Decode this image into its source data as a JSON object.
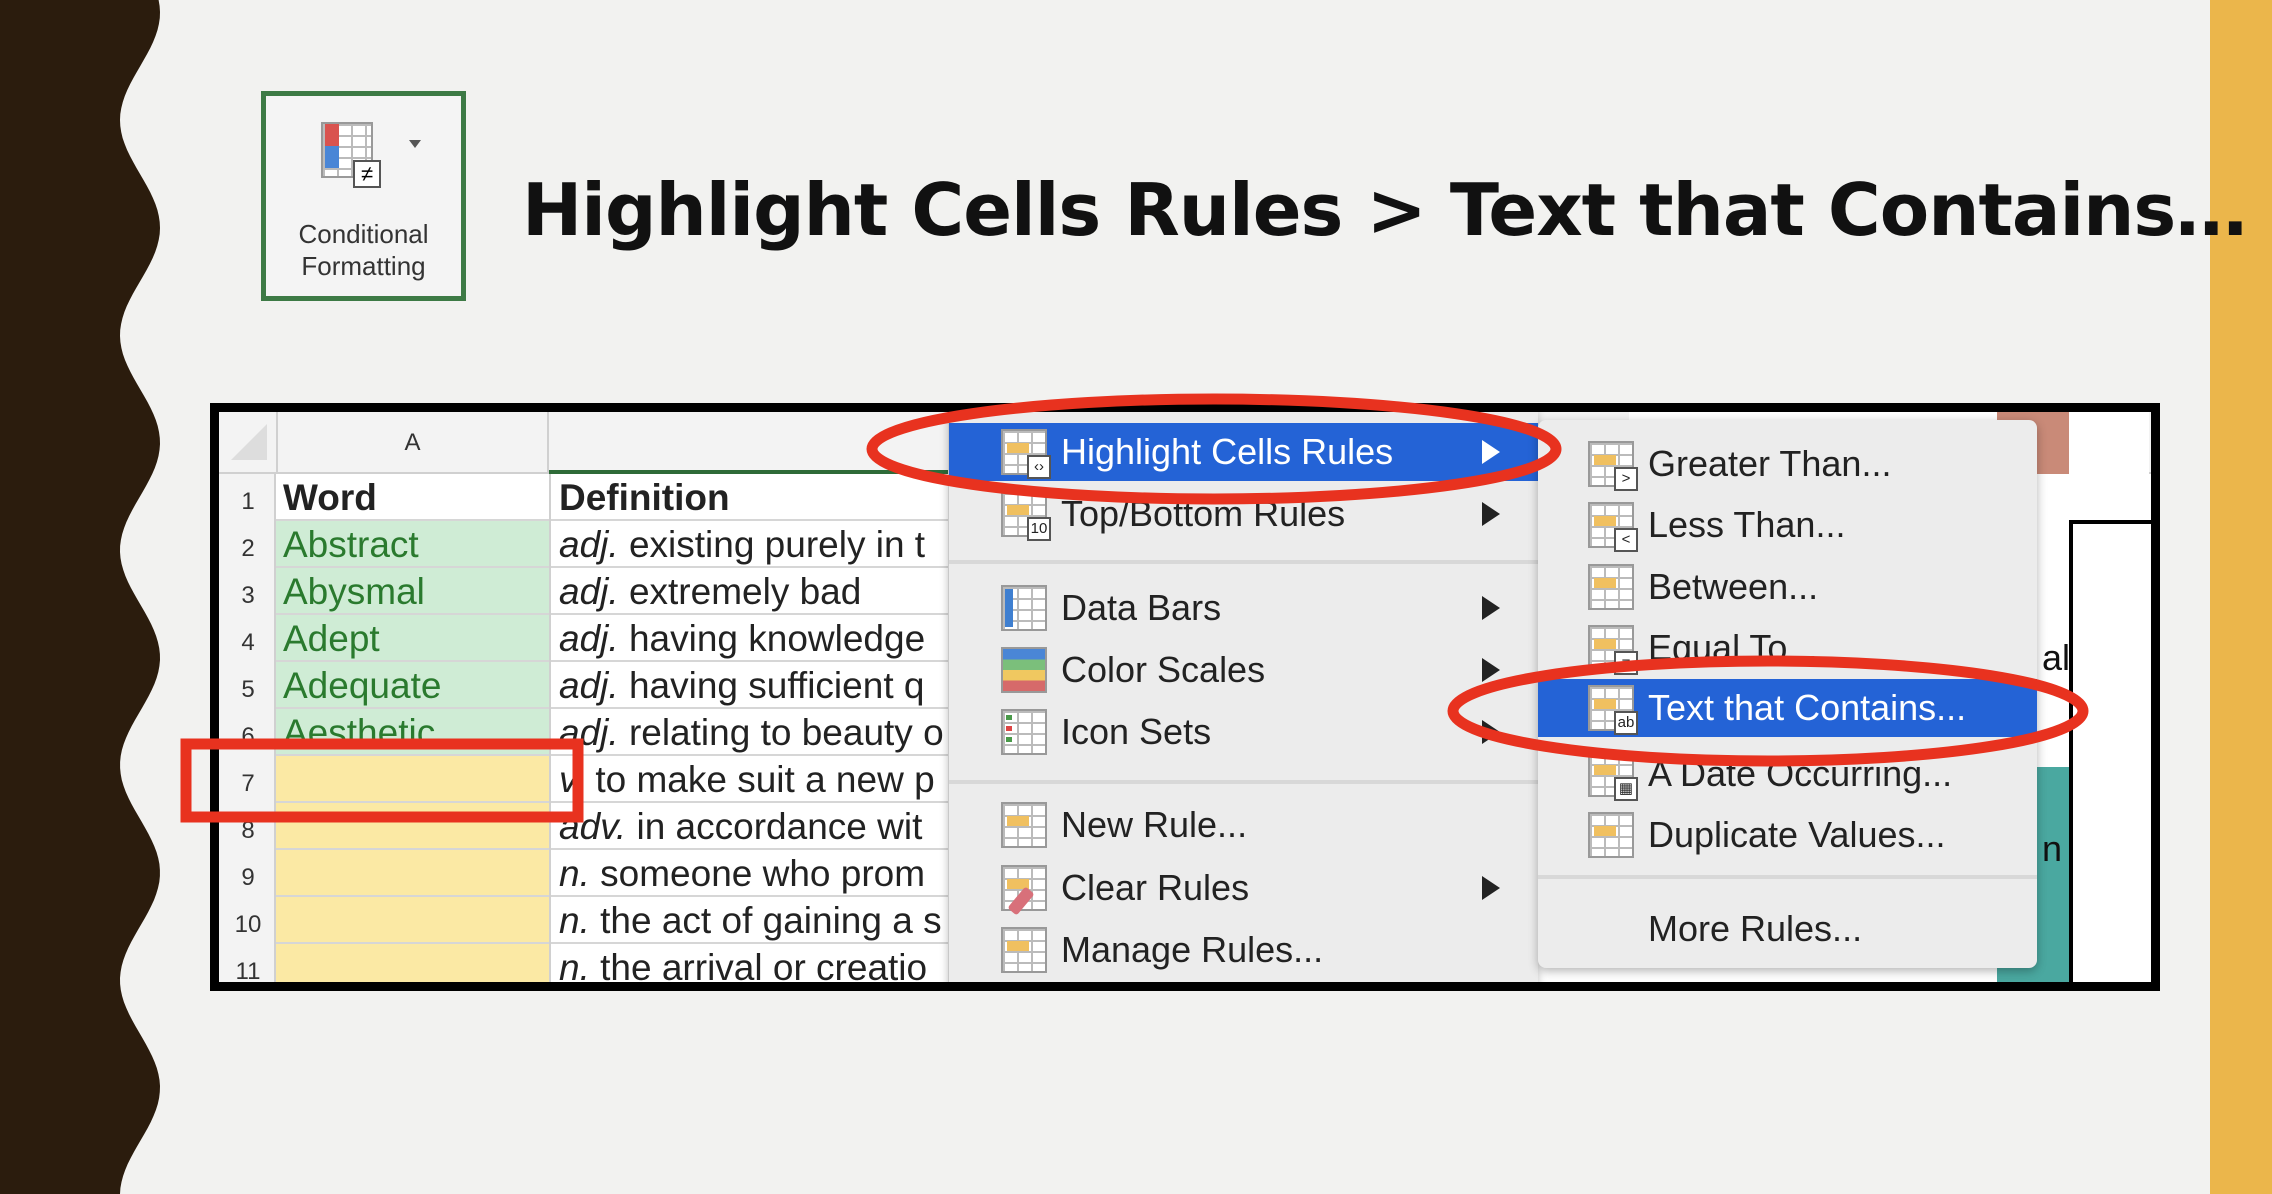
{
  "slide": {
    "title": "Highlight Cells Rules > Text that Contains…",
    "ribbon_button": {
      "line1": "Conditional",
      "line2": "Formatting"
    },
    "colors": {
      "left_band": "#2b1c0d",
      "right_band": "#ebb64b",
      "annotation": "#e8321f",
      "highlight": "#2463d6"
    }
  },
  "sheet": {
    "column_header": "A",
    "rows": [
      {
        "n": "1",
        "word": "Word",
        "def_pos": "",
        "def": "Definition"
      },
      {
        "n": "2",
        "word": "Abstract",
        "def_pos": "adj.",
        "def": "existing purely in t"
      },
      {
        "n": "3",
        "word": "Abysmal",
        "def_pos": "adj.",
        "def": "extremely bad"
      },
      {
        "n": "4",
        "word": "Adept",
        "def_pos": "adj.",
        "def": "having knowledge"
      },
      {
        "n": "5",
        "word": "Adequate",
        "def_pos": "adj.",
        "def": "having sufficient q"
      },
      {
        "n": "6",
        "word": "Aesthetic",
        "def_pos": "adj.",
        "def": "relating to beauty o"
      },
      {
        "n": "7",
        "word": "",
        "def_pos": "v.",
        "def": "to make suit a new p"
      },
      {
        "n": "8",
        "word": "",
        "def_pos": "adv.",
        "def": "in accordance wit"
      },
      {
        "n": "9",
        "word": "",
        "def_pos": "n.",
        "def": "someone who prom"
      },
      {
        "n": "10",
        "word": "",
        "def_pos": "n.",
        "def": "the act of gaining a s"
      },
      {
        "n": "11",
        "word": "",
        "def_pos": "n.",
        "def": "the arrival or creatio"
      }
    ],
    "right_fragments": [
      "al",
      "n"
    ]
  },
  "menu": {
    "items": [
      {
        "label": "Highlight Cells Rules",
        "icon": "highlight-cells-icon",
        "submenu": true,
        "selected": true
      },
      {
        "label": "Top/Bottom Rules",
        "icon": "top-bottom-icon",
        "submenu": true
      },
      {
        "label": "Data Bars",
        "icon": "data-bars-icon",
        "submenu": true
      },
      {
        "label": "Color Scales",
        "icon": "color-scales-icon",
        "submenu": true
      },
      {
        "label": "Icon Sets",
        "icon": "icon-sets-icon",
        "submenu": true
      },
      {
        "label": "New Rule...",
        "icon": "new-rule-icon"
      },
      {
        "label": "Clear Rules",
        "icon": "clear-rules-icon",
        "submenu": true
      },
      {
        "label": "Manage Rules...",
        "icon": "manage-rules-icon"
      }
    ]
  },
  "submenu": {
    "items": [
      {
        "label": "Greater Than...",
        "badge": ">"
      },
      {
        "label": "Less Than...",
        "badge": "<"
      },
      {
        "label": "Between...",
        "badge": ""
      },
      {
        "label": "Equal To...",
        "badge": "="
      },
      {
        "label": "Text that Contains...",
        "badge": "ab",
        "selected": true
      },
      {
        "label": "A Date Occurring...",
        "badge": "▦"
      },
      {
        "label": "Duplicate Values...",
        "badge": ""
      },
      {
        "label": "More Rules...",
        "badge": ""
      }
    ]
  }
}
